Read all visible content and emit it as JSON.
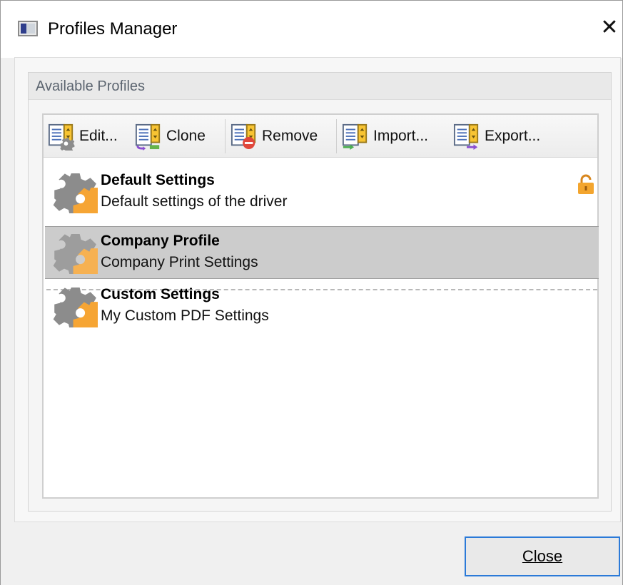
{
  "window": {
    "title": "Profiles Manager",
    "close_glyph": "✕"
  },
  "group": {
    "title": "Available Profiles"
  },
  "toolbar": {
    "buttons": [
      {
        "label": "Edit...",
        "icon": "edit-profile-icon"
      },
      {
        "label": "Clone",
        "icon": "clone-profile-icon"
      },
      {
        "label": "Remove",
        "icon": "remove-profile-icon"
      },
      {
        "label": "Import...",
        "icon": "import-profile-icon"
      },
      {
        "label": "Export...",
        "icon": "export-profile-icon"
      }
    ]
  },
  "profiles": [
    {
      "name": "Default Settings",
      "description": "Default settings of the driver",
      "locked": true,
      "selected": false
    },
    {
      "name": "Company Profile",
      "description": "Company Print Settings",
      "locked": false,
      "selected": true
    },
    {
      "name": "Custom Settings",
      "description": "My Custom PDF Settings",
      "locked": false,
      "selected": false
    }
  ],
  "footer": {
    "close_label": "Close"
  },
  "colors": {
    "accent": "#2b7ad8",
    "gear_gray": "#8c8c8c",
    "gear_orange": "#f6a534",
    "selected_row": "#cccccc"
  }
}
